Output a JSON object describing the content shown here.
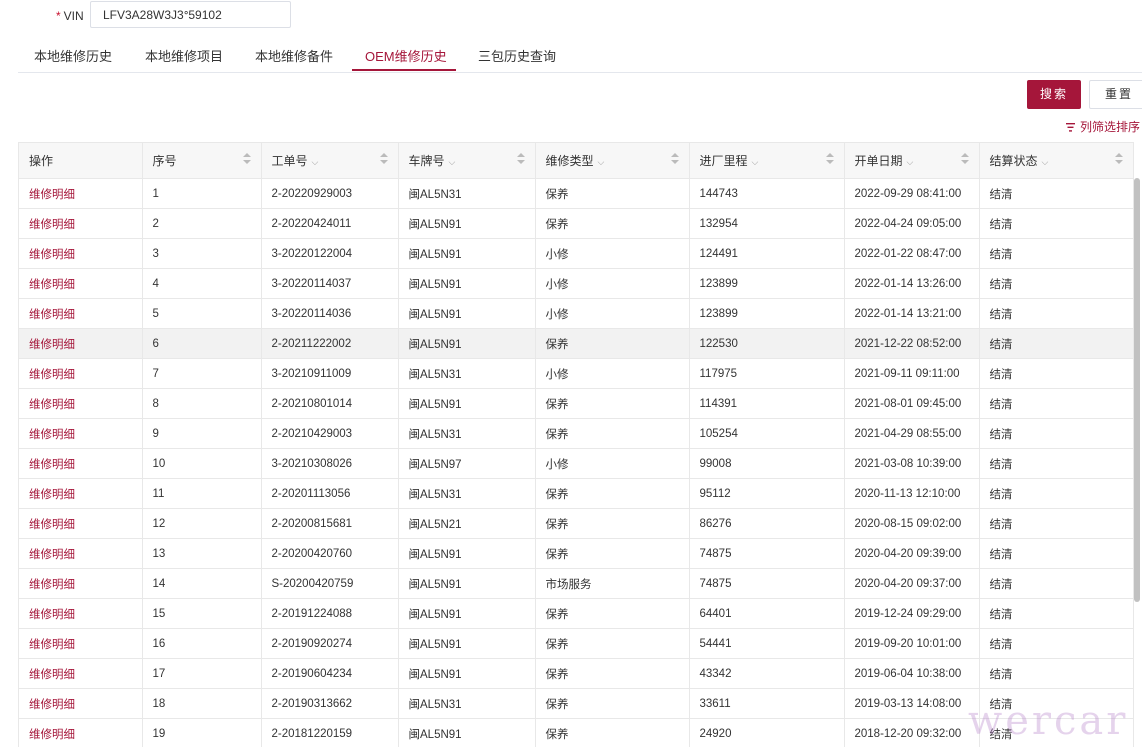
{
  "filter": {
    "vin_required": "*",
    "vin_label": "VIN",
    "vin_value": "LFV3A28W3J3ᐤ59102"
  },
  "tabs": [
    "本地维修历史",
    "本地维修项目",
    "本地维修备件",
    "OEM维修历史",
    "三包历史查询"
  ],
  "active_tab": "OEM维修历史",
  "buttons": {
    "search": "搜索",
    "reset": "重置"
  },
  "column_filter_label": "列筛选排序",
  "table": {
    "columns": [
      "操作",
      "序号",
      "工单号",
      "车牌号",
      "维修类型",
      "进厂里程",
      "开单日期",
      "结算状态"
    ],
    "rows": [
      {
        "op": "维修明细",
        "seq": "1",
        "order": "2-20220929003",
        "plate": "闽AL5N31",
        "type": "保养",
        "mileage": "144743",
        "date": "2022-09-29 08:41:00",
        "status": "结清"
      },
      {
        "op": "维修明细",
        "seq": "2",
        "order": "2-20220424011",
        "plate": "闽AL5N91",
        "type": "保养",
        "mileage": "132954",
        "date": "2022-04-24 09:05:00",
        "status": "结清"
      },
      {
        "op": "维修明细",
        "seq": "3",
        "order": "3-20220122004",
        "plate": "闽AL5N91",
        "type": "小修",
        "mileage": "124491",
        "date": "2022-01-22 08:47:00",
        "status": "结清"
      },
      {
        "op": "维修明细",
        "seq": "4",
        "order": "3-20220114037",
        "plate": "闽AL5N91",
        "type": "小修",
        "mileage": "123899",
        "date": "2022-01-14 13:26:00",
        "status": "结清"
      },
      {
        "op": "维修明细",
        "seq": "5",
        "order": "3-20220114036",
        "plate": "闽AL5N91",
        "type": "小修",
        "mileage": "123899",
        "date": "2022-01-14 13:21:00",
        "status": "结清"
      },
      {
        "op": "维修明细",
        "seq": "6",
        "order": "2-20211222002",
        "plate": "闽AL5N91",
        "type": "保养",
        "mileage": "122530",
        "date": "2021-12-22 08:52:00",
        "status": "结清"
      },
      {
        "op": "维修明细",
        "seq": "7",
        "order": "3-20210911009",
        "plate": "闽AL5N31",
        "type": "小修",
        "mileage": "117975",
        "date": "2021-09-11 09:11:00",
        "status": "结清"
      },
      {
        "op": "维修明细",
        "seq": "8",
        "order": "2-20210801014",
        "plate": "闽AL5N91",
        "type": "保养",
        "mileage": "114391",
        "date": "2021-08-01 09:45:00",
        "status": "结清"
      },
      {
        "op": "维修明细",
        "seq": "9",
        "order": "2-20210429003",
        "plate": "闽AL5N31",
        "type": "保养",
        "mileage": "105254",
        "date": "2021-04-29 08:55:00",
        "status": "结清"
      },
      {
        "op": "维修明细",
        "seq": "10",
        "order": "3-20210308026",
        "plate": "闽AL5N97",
        "type": "小修",
        "mileage": "99008",
        "date": "2021-03-08 10:39:00",
        "status": "结清"
      },
      {
        "op": "维修明细",
        "seq": "11",
        "order": "2-20201113056",
        "plate": "闽AL5N31",
        "type": "保养",
        "mileage": "95112",
        "date": "2020-11-13 12:10:00",
        "status": "结清"
      },
      {
        "op": "维修明细",
        "seq": "12",
        "order": "2-20200815681",
        "plate": "闽AL5N21",
        "type": "保养",
        "mileage": "86276",
        "date": "2020-08-15 09:02:00",
        "status": "结清"
      },
      {
        "op": "维修明细",
        "seq": "13",
        "order": "2-20200420760",
        "plate": "闽AL5N91",
        "type": "保养",
        "mileage": "74875",
        "date": "2020-04-20 09:39:00",
        "status": "结清"
      },
      {
        "op": "维修明细",
        "seq": "14",
        "order": "S-20200420759",
        "plate": "闽AL5N91",
        "type": "市场服务",
        "mileage": "74875",
        "date": "2020-04-20 09:37:00",
        "status": "结清"
      },
      {
        "op": "维修明细",
        "seq": "15",
        "order": "2-20191224088",
        "plate": "闽AL5N91",
        "type": "保养",
        "mileage": "64401",
        "date": "2019-12-24 09:29:00",
        "status": "结清"
      },
      {
        "op": "维修明细",
        "seq": "16",
        "order": "2-20190920274",
        "plate": "闽AL5N91",
        "type": "保养",
        "mileage": "54441",
        "date": "2019-09-20 10:01:00",
        "status": "结清"
      },
      {
        "op": "维修明细",
        "seq": "17",
        "order": "2-20190604234",
        "plate": "闽AL5N91",
        "type": "保养",
        "mileage": "43342",
        "date": "2019-06-04 10:38:00",
        "status": "结清"
      },
      {
        "op": "维修明细",
        "seq": "18",
        "order": "2-20190313662",
        "plate": "闽AL5N31",
        "type": "保养",
        "mileage": "33611",
        "date": "2019-03-13 14:08:00",
        "status": "结清"
      },
      {
        "op": "维修明细",
        "seq": "19",
        "order": "2-20181220159",
        "plate": "闽AL5N91",
        "type": "保养",
        "mileage": "24920",
        "date": "2018-12-20 09:32:00",
        "status": "结清"
      }
    ],
    "highlighted_row": 6
  },
  "watermark": "wercar",
  "colors": {
    "accent": "#a5163a",
    "border": "#e8e8e8",
    "header_bg": "#f7f7f7"
  },
  "icons": {
    "filter_dropdown": "chevron-down-icon",
    "sort": "sort-caret-icon",
    "column_filter": "filter-icon"
  }
}
